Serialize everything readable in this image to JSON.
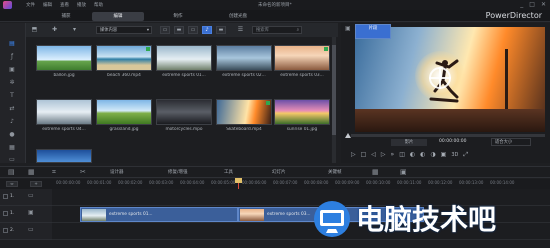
{
  "window": {
    "menu": [
      "文件",
      "编辑",
      "查看",
      "播放",
      "帮助",
      "帮助"
    ],
    "project_title": "未命名的新项目*",
    "controls": [
      "_",
      "□",
      "✕"
    ]
  },
  "tabs": {
    "items": [
      {
        "label": "捕获",
        "active": false
      },
      {
        "label": "编辑",
        "active": true
      },
      {
        "label": "制作",
        "active": false
      },
      {
        "label": "创建光盘",
        "active": false
      }
    ],
    "brand": "PowerDirector"
  },
  "library": {
    "filter_label": "媒体内容",
    "search_placeholder": "搜索库",
    "items": [
      {
        "caption": "ballon.jpg",
        "checked": false
      },
      {
        "caption": "beach 360.mp4",
        "checked": true
      },
      {
        "caption": "extreme sports 01...",
        "checked": false
      },
      {
        "caption": "extreme sports 02...",
        "checked": false
      },
      {
        "caption": "extreme sports 03...",
        "checked": true
      },
      {
        "caption": "extreme sports 04...",
        "checked": false
      },
      {
        "caption": "grassland.jpg",
        "checked": false
      },
      {
        "caption": "motorcycles.mpo",
        "checked": false
      },
      {
        "caption": "Skateboard.mp4",
        "checked": true
      },
      {
        "caption": "sunrise 01.jpg",
        "checked": false
      },
      {
        "caption": "",
        "checked": false
      }
    ]
  },
  "preview": {
    "mode_clip": "片段",
    "mode_movie": "影片",
    "timecode": "00:00:00:00",
    "fit_label": "适合大小",
    "transport_3d": "3D"
  },
  "timeline_toolbar": {
    "designer": "设计器",
    "repair": "修复/增强",
    "tools": "工具",
    "slideshow": "幻灯片",
    "keyframe": "关键帧"
  },
  "ruler": {
    "ticks": [
      "00:00:00:00",
      "00:00:01:00",
      "00:00:02:00",
      "00:00:03:00",
      "00:00:04:00",
      "00:00:05:00",
      "00:00:06:00",
      "00:00:07:00",
      "00:00:08:00",
      "00:00:09:00",
      "00:00:10:00",
      "00:00:11:00",
      "00:00:12:00",
      "00:00:13:00",
      "00:00:14:00"
    ]
  },
  "tracks": [
    {
      "number": "1.",
      "clips": []
    },
    {
      "number": "1.",
      "clips": [
        {
          "label": "extreme sports 01..."
        },
        {
          "label": "extreme sports 03..."
        }
      ]
    },
    {
      "number": "2.",
      "clips": []
    }
  ],
  "watermark": {
    "text": "电脑技术吧"
  }
}
